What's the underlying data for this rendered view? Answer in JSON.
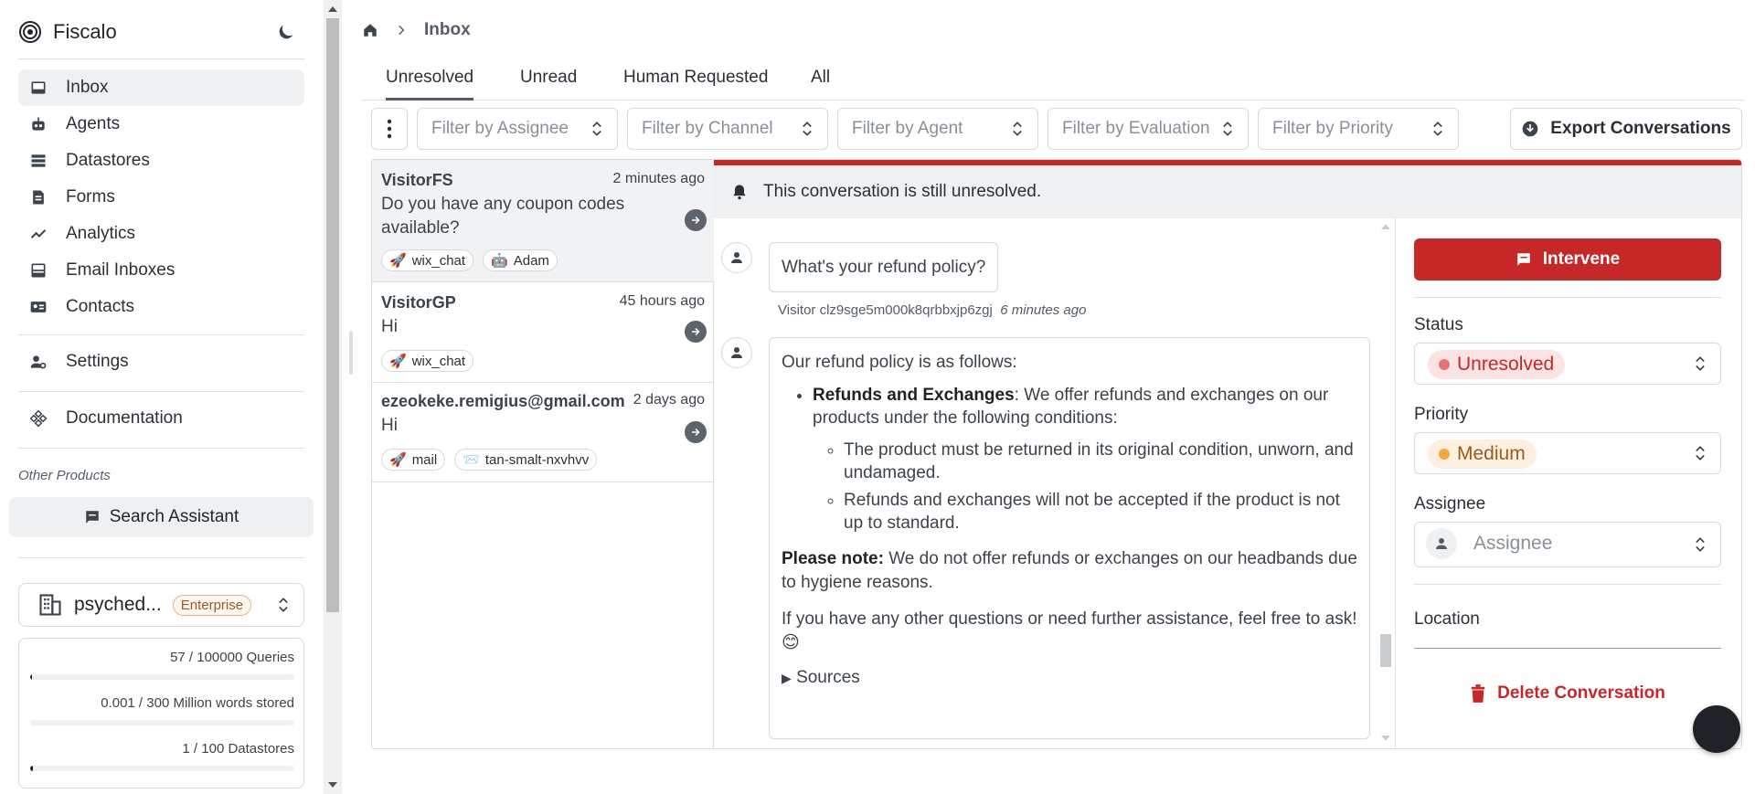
{
  "app": {
    "name": "Fiscalo"
  },
  "sidebar": {
    "items": [
      {
        "label": "Inbox",
        "icon": "inbox-icon",
        "active": true
      },
      {
        "label": "Agents",
        "icon": "robot-icon"
      },
      {
        "label": "Datastores",
        "icon": "datastore-icon"
      },
      {
        "label": "Forms",
        "icon": "form-icon"
      },
      {
        "label": "Analytics",
        "icon": "chart-line-icon"
      },
      {
        "label": "Email Inboxes",
        "icon": "email-inbox-icon"
      },
      {
        "label": "Contacts",
        "icon": "contacts-icon"
      }
    ],
    "settings_label": "Settings",
    "documentation_label": "Documentation",
    "other_products_label": "Other Products",
    "search_assistant_label": "Search Assistant",
    "org": {
      "name": "psyched...",
      "plan": "Enterprise"
    },
    "usage": [
      {
        "text": "57 / 100000 Queries",
        "fraction": 0.0006
      },
      {
        "text": "0.001 / 300 Million words stored",
        "fraction": 0.0
      },
      {
        "text": "1 / 100 Datastores",
        "fraction": 0.01
      }
    ]
  },
  "breadcrumb": {
    "current": "Inbox"
  },
  "tabs": [
    {
      "label": "Unresolved",
      "active": true
    },
    {
      "label": "Unread"
    },
    {
      "label": "Human Requested"
    },
    {
      "label": "All"
    }
  ],
  "filters": {
    "assignee": "Filter by Assignee",
    "channel": "Filter by Channel",
    "agent": "Filter by Agent",
    "evaluation": "Filter by Evaluation",
    "priority": "Filter by Priority"
  },
  "export_label": "Export Conversations",
  "conversations": [
    {
      "name": "VisitorFS",
      "time": "2 minutes ago",
      "message": "Do you have any coupon codes available?",
      "chips": [
        {
          "label": "wix_chat",
          "icon": "rocket-icon"
        },
        {
          "label": "Adam",
          "icon": "robot-icon"
        }
      ],
      "selected": true
    },
    {
      "name": "VisitorGP",
      "time": "45 hours ago",
      "message": "Hi",
      "chips": [
        {
          "label": "wix_chat",
          "icon": "rocket-icon"
        }
      ]
    },
    {
      "name": "ezeokeke.remigius@gmail.com",
      "time": "2 days ago",
      "message": "Hi",
      "chips": [
        {
          "label": "mail",
          "icon": "rocket-icon"
        },
        {
          "label": "tan-smalt-nxvhvv",
          "icon": "envelope-icon"
        }
      ]
    }
  ],
  "banner": {
    "text": "This conversation is still unresolved."
  },
  "thread": {
    "question": "What's your refund policy?",
    "question_author": "Visitor clz9sge5m000k8qrbbxjp6zgj",
    "question_time": "6 minutes ago",
    "answer": {
      "intro": "Our refund policy is as follows:",
      "bullet_title": "Refunds and Exchanges",
      "bullet_text": ": We offer refunds and exchanges on our products under the following conditions:",
      "sub_bullets": [
        "The product must be returned in its original condition, unworn, and undamaged.",
        "Refunds and exchanges will not be accepted if the product is not up to standard."
      ],
      "note_label": "Please note:",
      "note_text": " We do not offer refunds or exchanges on our headbands due to hygiene reasons.",
      "closing": "If you have any other questions or need further assistance, feel free to ask!",
      "emoji": "😊",
      "sources_label": "Sources"
    }
  },
  "details": {
    "intervene_label": "Intervene",
    "status_label": "Status",
    "status_value": "Unresolved",
    "priority_label": "Priority",
    "priority_value": "Medium",
    "assignee_label": "Assignee",
    "assignee_placeholder": "Assignee",
    "location_label": "Location",
    "delete_label": "Delete Conversation"
  },
  "colors": {
    "danger": "#c62828",
    "status_dot": "#e57373",
    "status_bg": "#fde4e4",
    "priority_dot": "#f5a742",
    "priority_bg": "#fdf0e0"
  }
}
